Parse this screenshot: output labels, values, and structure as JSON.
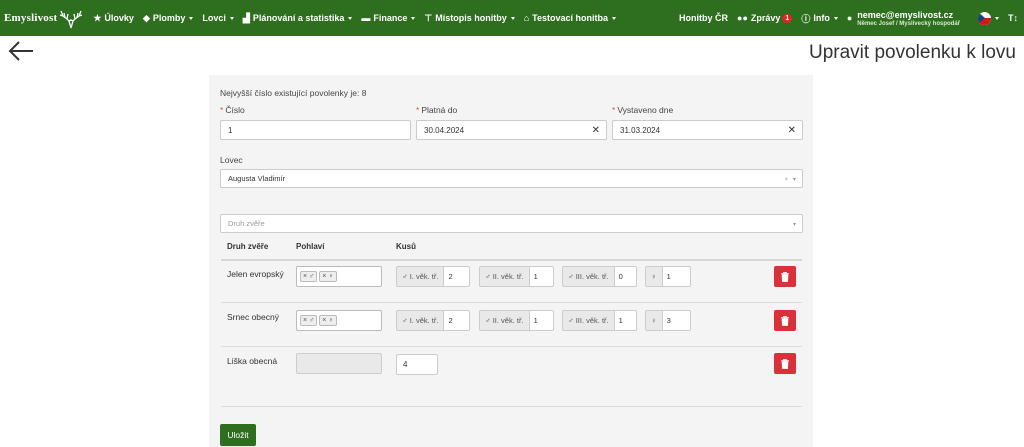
{
  "navbar": {
    "brand": "Emyslivost",
    "items": [
      {
        "icon": "star-icon",
        "glyph": "★",
        "label": "Úlovky",
        "dropdown": false
      },
      {
        "icon": "tag-icon",
        "glyph": "◆",
        "label": "Plomby",
        "dropdown": true
      },
      {
        "icon": "",
        "glyph": "",
        "label": "Lovci",
        "dropdown": true
      },
      {
        "icon": "chart-icon",
        "glyph": "▟",
        "label": "Plánování a statistika",
        "dropdown": true
      },
      {
        "icon": "money-icon",
        "glyph": "▬",
        "label": "Finance",
        "dropdown": true
      },
      {
        "icon": "signpost-icon",
        "glyph": "⊤",
        "label": "Místopis honitby",
        "dropdown": true
      },
      {
        "icon": "home-icon",
        "glyph": "⌂",
        "label": "Testovací honitba",
        "dropdown": true
      }
    ],
    "right": {
      "honitby": "Honitby ČR",
      "messages_label": "Zprávy",
      "messages_count": "1",
      "info_label": "Info",
      "user_email": "nemec@emyslivost.cz",
      "user_sub": "Němec Josef / Myslivecký hospodář",
      "font_size_icon": "T↕"
    }
  },
  "page": {
    "title": "Upravit povolenku k lovu"
  },
  "form": {
    "highest_number_note": "Nejvyšší číslo existující povolenky je: 8",
    "number_label": "Číslo",
    "number_value": "1",
    "valid_until_label": "Platná do",
    "valid_until_value": "30.04.2024",
    "issued_label": "Vystaveno dne",
    "issued_value": "31.03.2024",
    "hunter_label": "Lovec",
    "hunter_value": "Augusta Vladimír",
    "species_placeholder": "Druh zvěře",
    "columns": [
      "Druh zvěře",
      "Pohlaví",
      "Kusů"
    ],
    "rows": [
      {
        "species": "Jelen evropský",
        "genders": [
          "× ♂",
          "× ♀"
        ],
        "classes": [
          {
            "label": "♂ I. věk. tř.",
            "value": "2"
          },
          {
            "label": "♂ II. věk. tř.",
            "value": "1"
          },
          {
            "label": "♂ III. věk. tř.",
            "value": "0"
          },
          {
            "label": "♀",
            "value": "1"
          }
        ]
      },
      {
        "species": "Srnec obecný",
        "genders": [
          "× ♂",
          "× ♀"
        ],
        "classes": [
          {
            "label": "♂ I. věk. tř.",
            "value": "2"
          },
          {
            "label": "♂ II. věk. tř.",
            "value": "1"
          },
          {
            "label": "♂ III. věk. tř.",
            "value": "1"
          },
          {
            "label": "♀",
            "value": "3"
          }
        ]
      },
      {
        "species": "Liška obecná",
        "count": "4"
      }
    ],
    "save_label": "Uložit"
  }
}
